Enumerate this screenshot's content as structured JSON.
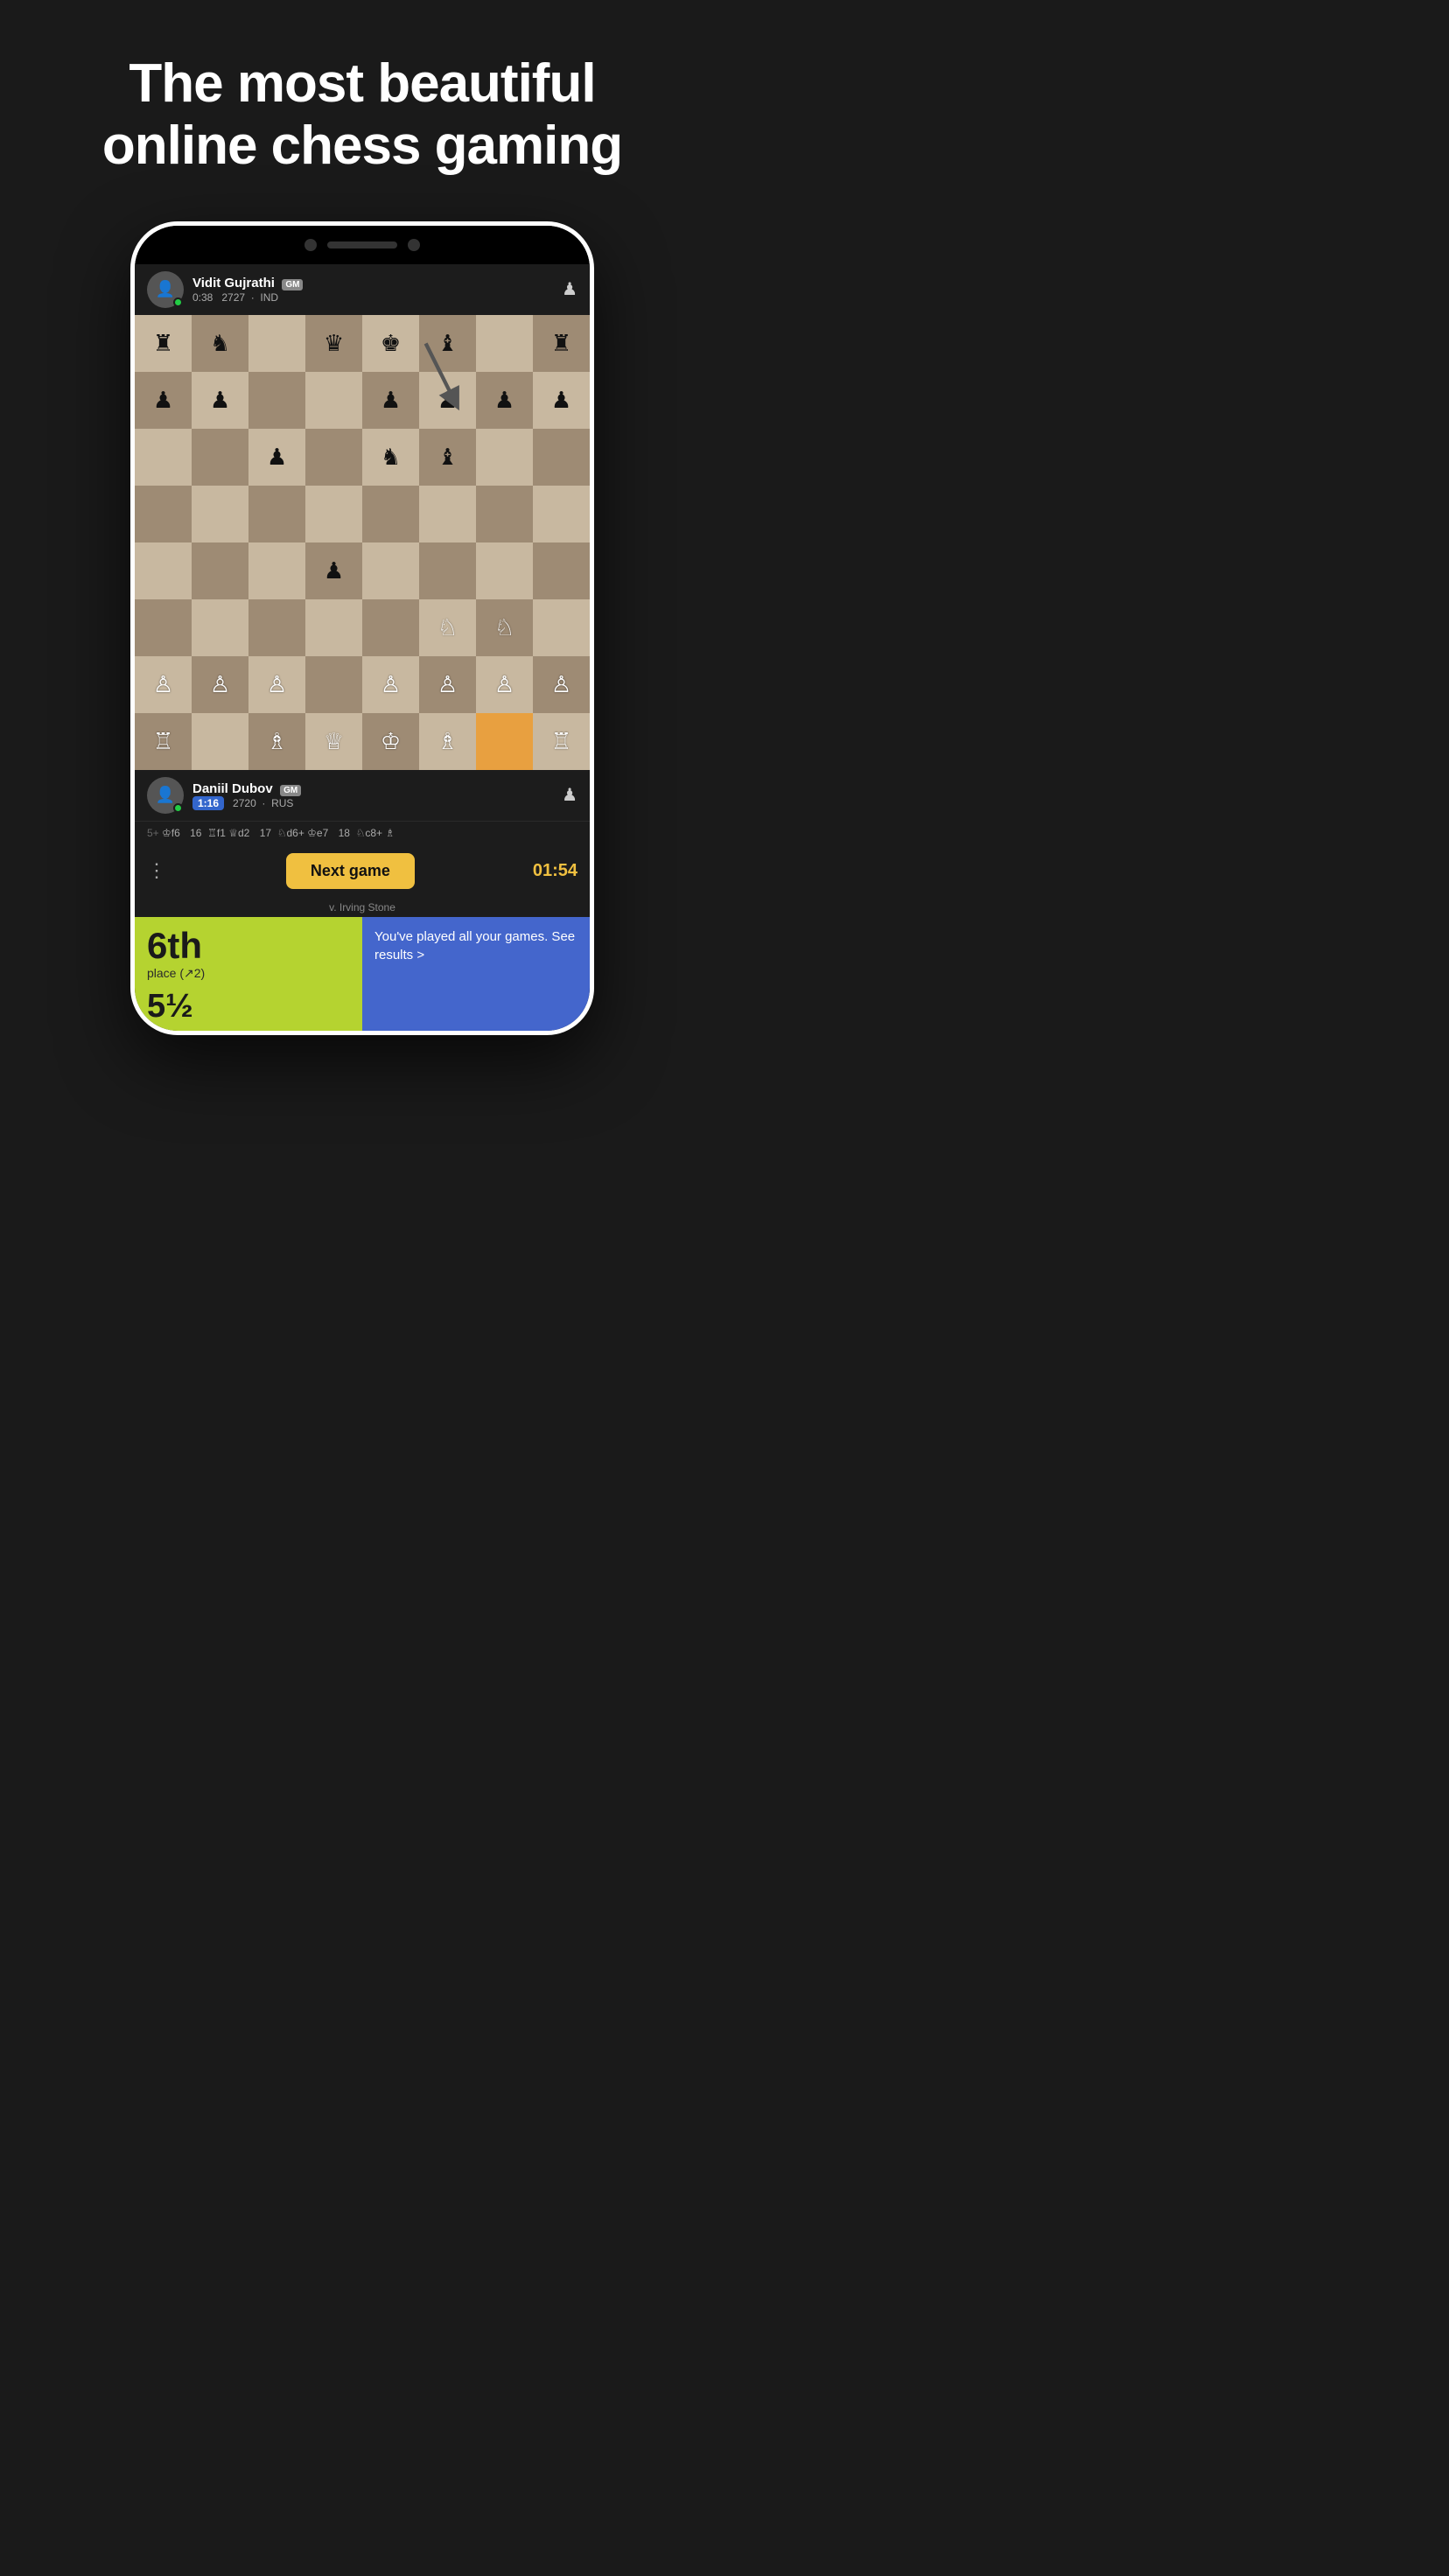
{
  "hero": {
    "line1": "The most beautiful",
    "line2": "online chess gaming"
  },
  "player_top": {
    "name": "Vidit Gujrathi",
    "badge": "GM",
    "time": "0:38",
    "rating": "2727",
    "country": "IND",
    "online": true
  },
  "player_bottom": {
    "name": "Daniil Dubov",
    "badge": "GM",
    "time": "1:16",
    "rating": "2720",
    "country": "RUS",
    "online": true
  },
  "moves": [
    {
      "num": "5+",
      "notation": "♔f6"
    },
    {
      "num": "16",
      "notation": "♖f1 ♕d2"
    },
    {
      "num": "17",
      "notation": "♘d6+ ♔e7"
    },
    {
      "num": "18",
      "notation": "♘c8+ ♗"
    }
  ],
  "next_game": {
    "label": "Next game",
    "timer": "01:54",
    "vs": "v. Irving Stone"
  },
  "stats": {
    "rank": "6th",
    "rank_sub": "place (↗2)",
    "score": "5½",
    "blue_text": "You've played all your games. See results >"
  },
  "board": {
    "highlight_cell": "g1",
    "pieces": [
      [
        "r",
        "n",
        "",
        "q",
        "k",
        "b",
        "",
        "r"
      ],
      [
        "p",
        "p",
        "",
        "",
        "p",
        "p",
        "p",
        "p"
      ],
      [
        "",
        "",
        "p",
        "",
        "n",
        "b",
        "",
        ""
      ],
      [
        "",
        "",
        "",
        "",
        "",
        "",
        "",
        ""
      ],
      [
        "",
        "",
        "",
        "p",
        "",
        "",
        "",
        ""
      ],
      [
        "",
        "",
        "",
        "",
        "",
        "N",
        "N",
        ""
      ],
      [
        "P",
        "P",
        "P",
        "",
        "P",
        "P",
        "P",
        "P"
      ],
      [
        "R",
        "",
        "B",
        "Q",
        "K",
        "B",
        "",
        "R"
      ]
    ]
  }
}
